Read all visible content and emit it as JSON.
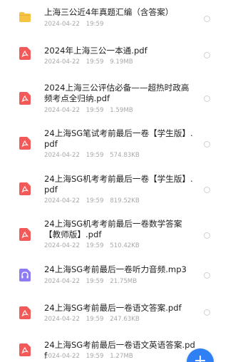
{
  "files": [
    {
      "name": "上海三公近4年真题汇编（含答案）",
      "date": "2024-04-22",
      "time": "19:59",
      "size": "",
      "icon": "folder-icon"
    },
    {
      "name": "2024年上海三公一本通.pdf",
      "date": "2024-04-22",
      "time": "19:59",
      "size": "9.19MB",
      "icon": "pdf-icon"
    },
    {
      "name": "2024上海三公评估必备——超热时政高频考点全归纳.pdf",
      "date": "2024-04-22",
      "time": "19:59",
      "size": "1.59MB",
      "icon": "pdf-icon"
    },
    {
      "name": "24上海SG笔试考前最后一卷【学生版】.pdf",
      "date": "2024-04-22",
      "time": "19:59",
      "size": "574.83KB",
      "icon": "pdf-icon"
    },
    {
      "name": "24上海SG机考考前最后一卷【学生版】.pdf",
      "date": "2024-04-22",
      "time": "19:59",
      "size": "819.52KB",
      "icon": "pdf-icon"
    },
    {
      "name": "24上海SG机考考前最后一卷数学答案【教师版】.pdf",
      "date": "2024-04-22",
      "time": "19:59",
      "size": "510.42KB",
      "icon": "pdf-icon"
    },
    {
      "name": "24上海SG考前最后一卷听力音频.mp3",
      "date": "2024-04-22",
      "time": "19:59",
      "size": "21.75MB",
      "icon": "audio-icon"
    },
    {
      "name": "24上海SG考前最后一卷语文答案.pdf",
      "date": "2024-04-22",
      "time": "19:59",
      "size": "247.63KB",
      "icon": "pdf-icon"
    },
    {
      "name": "24上海SG考前最后一卷语文英语答案.pdf",
      "date": "2024-04-22",
      "time": "19:59",
      "size": "1.27MB",
      "icon": "pdf-icon"
    }
  ],
  "fab": {
    "label": "+",
    "icon": "plus-icon"
  },
  "colors": {
    "pdf": "#f25a5a",
    "folder": "#f6c343",
    "audio": "#8e7cf5",
    "fab": "#2f80f5"
  }
}
